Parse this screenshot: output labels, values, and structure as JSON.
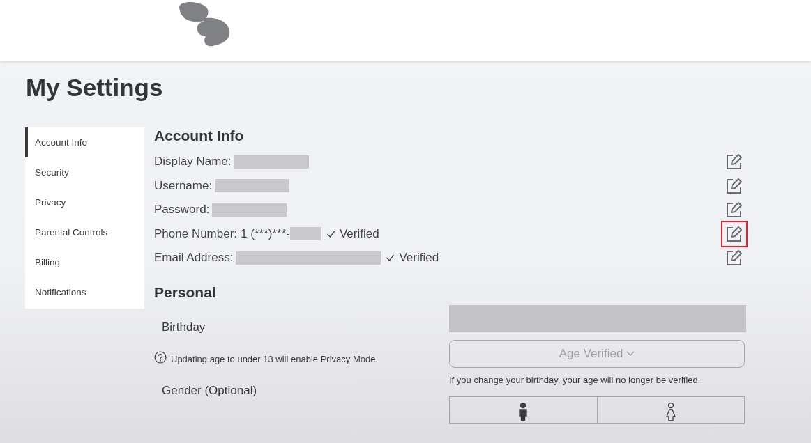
{
  "title": "My Settings",
  "sidebar": {
    "items": [
      {
        "label": "Account Info",
        "selected": true
      },
      {
        "label": "Security",
        "selected": false
      },
      {
        "label": "Privacy",
        "selected": false
      },
      {
        "label": "Parental Controls",
        "selected": false
      },
      {
        "label": "Billing",
        "selected": false
      },
      {
        "label": "Notifications",
        "selected": false
      }
    ]
  },
  "account_info": {
    "heading": "Account Info",
    "rows": [
      {
        "kind": "text",
        "label": "Display Name:",
        "redacted": true,
        "highlighted": false
      },
      {
        "kind": "text",
        "label": "Username:",
        "redacted": true,
        "highlighted": false
      },
      {
        "kind": "text",
        "label": "Password:",
        "redacted": true,
        "highlighted": false
      },
      {
        "kind": "phone",
        "label": "Phone Number:",
        "value": "1 (***)***-",
        "redacted": true,
        "verified": "Verified",
        "highlighted": true
      },
      {
        "kind": "email",
        "label": "Email Address:",
        "redacted": true,
        "verified": "Verified",
        "highlighted": false
      }
    ]
  },
  "personal": {
    "heading": "Personal",
    "birthday": {
      "label": "Birthday",
      "hint": "Updating age to under 13 will enable Privacy Mode.",
      "button": "Age Verified",
      "note": "If you change your birthday, your age will no longer be verified."
    },
    "gender": {
      "label": "Gender (Optional)",
      "options": [
        {
          "kind": "male",
          "selected": true
        },
        {
          "kind": "female",
          "selected": false
        }
      ]
    }
  }
}
